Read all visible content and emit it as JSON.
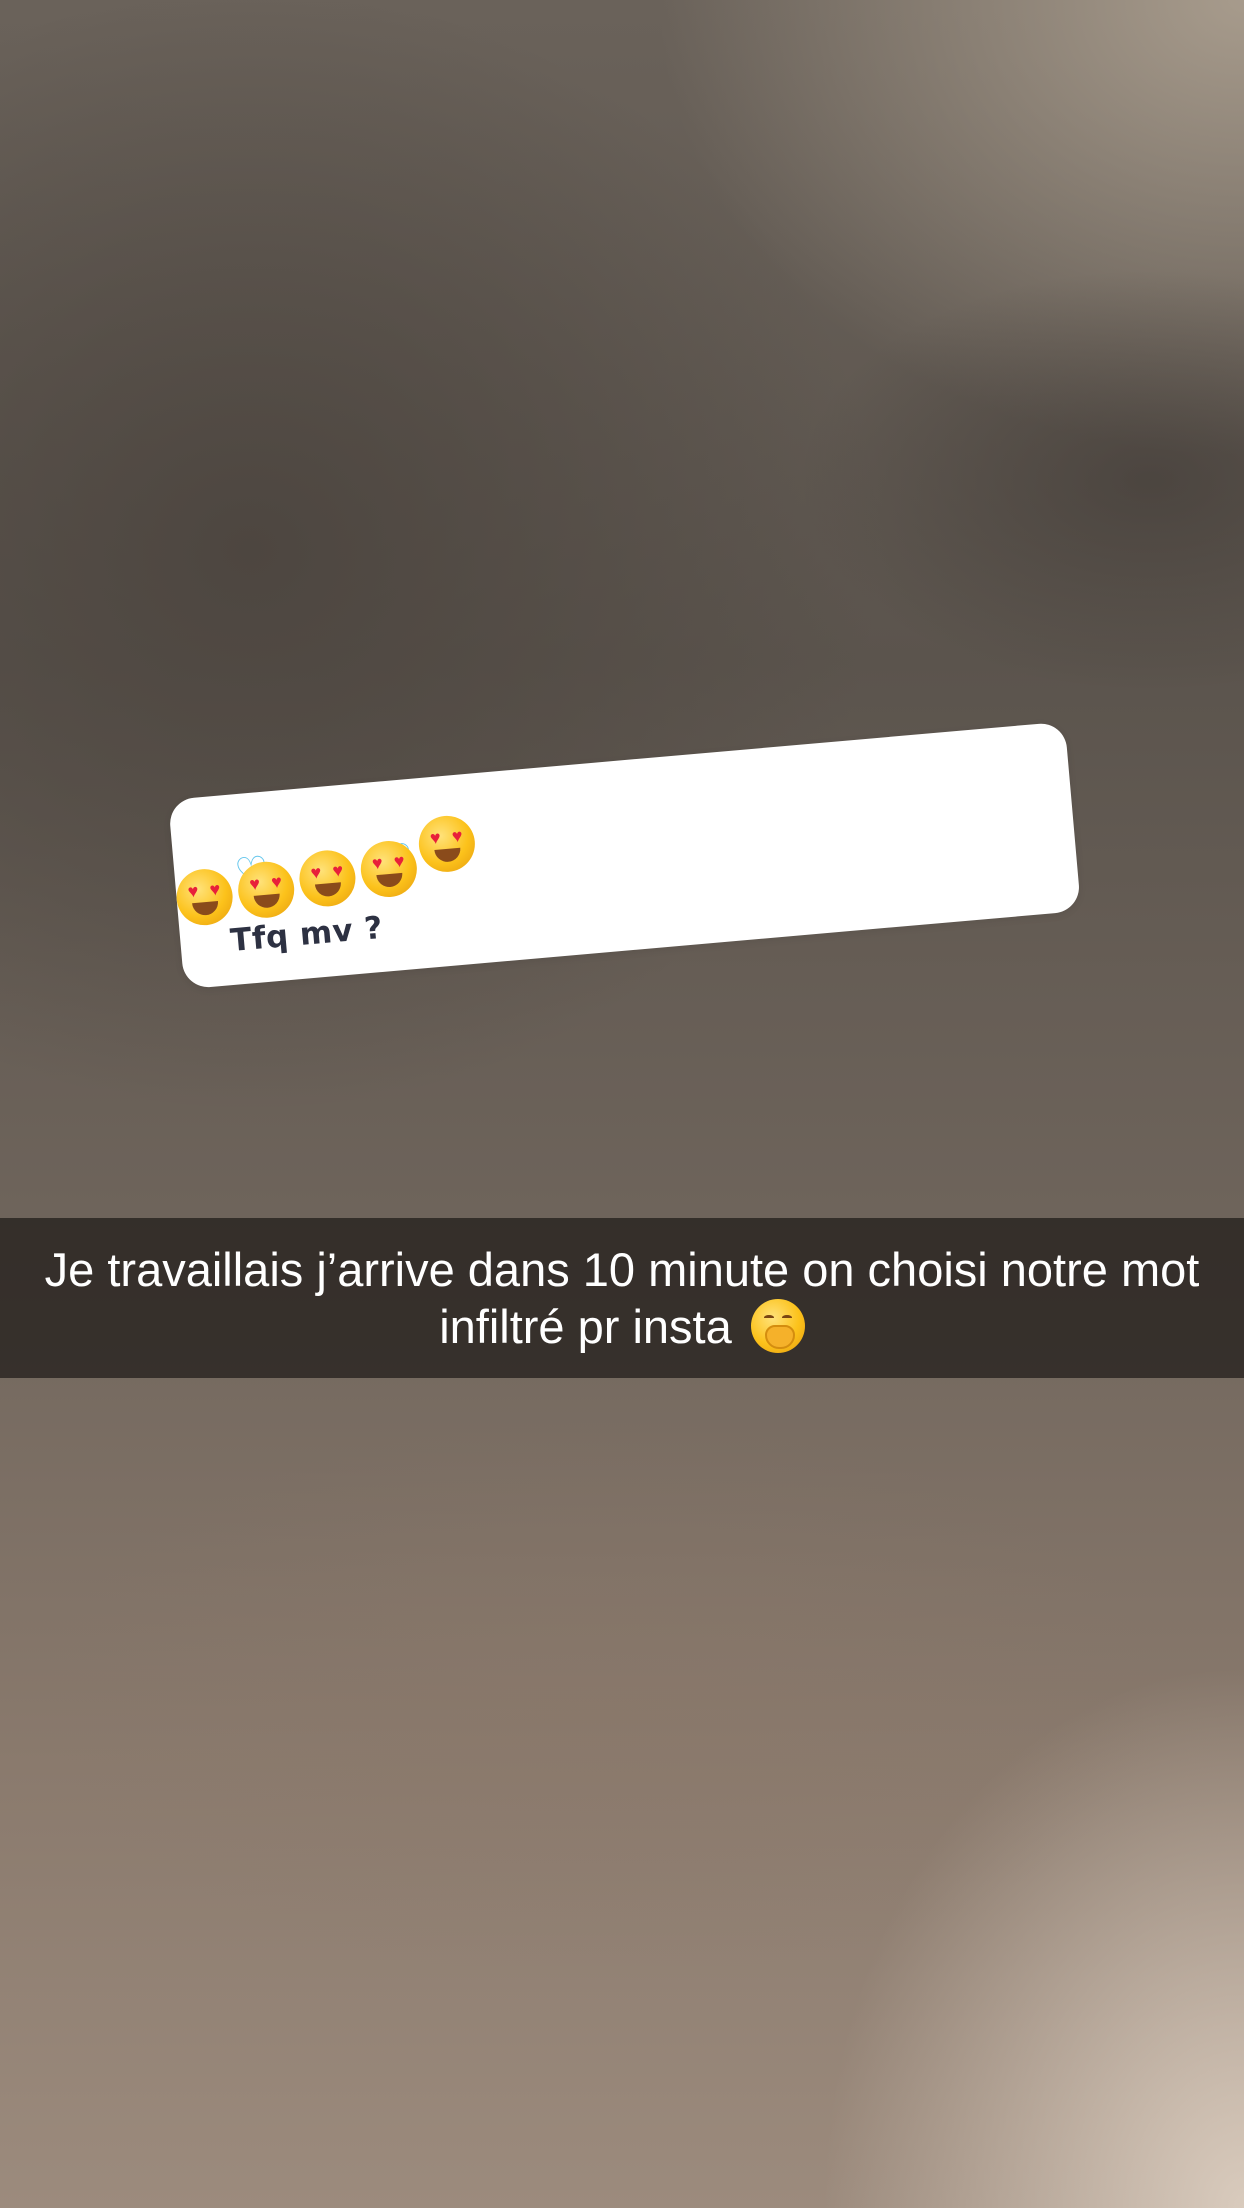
{
  "background": {
    "description_colors": [
      "#5b544d",
      "#8a7a6d",
      "#d9cbbd"
    ]
  },
  "sticker": {
    "emojis": [
      "heart-eyes-emoji",
      "heart-eyes-emoji",
      "heart-eyes-emoji",
      "heart-eyes-emoji",
      "heart-eyes-emoji"
    ],
    "text": "Tfq mv ?"
  },
  "caption": {
    "text": "Je travaillais j’arrive dans 10 minute on choisi notre mot infiltré pr insta",
    "emoji": "hand-over-mouth-emoji",
    "bar_color": "#1e1a18"
  }
}
